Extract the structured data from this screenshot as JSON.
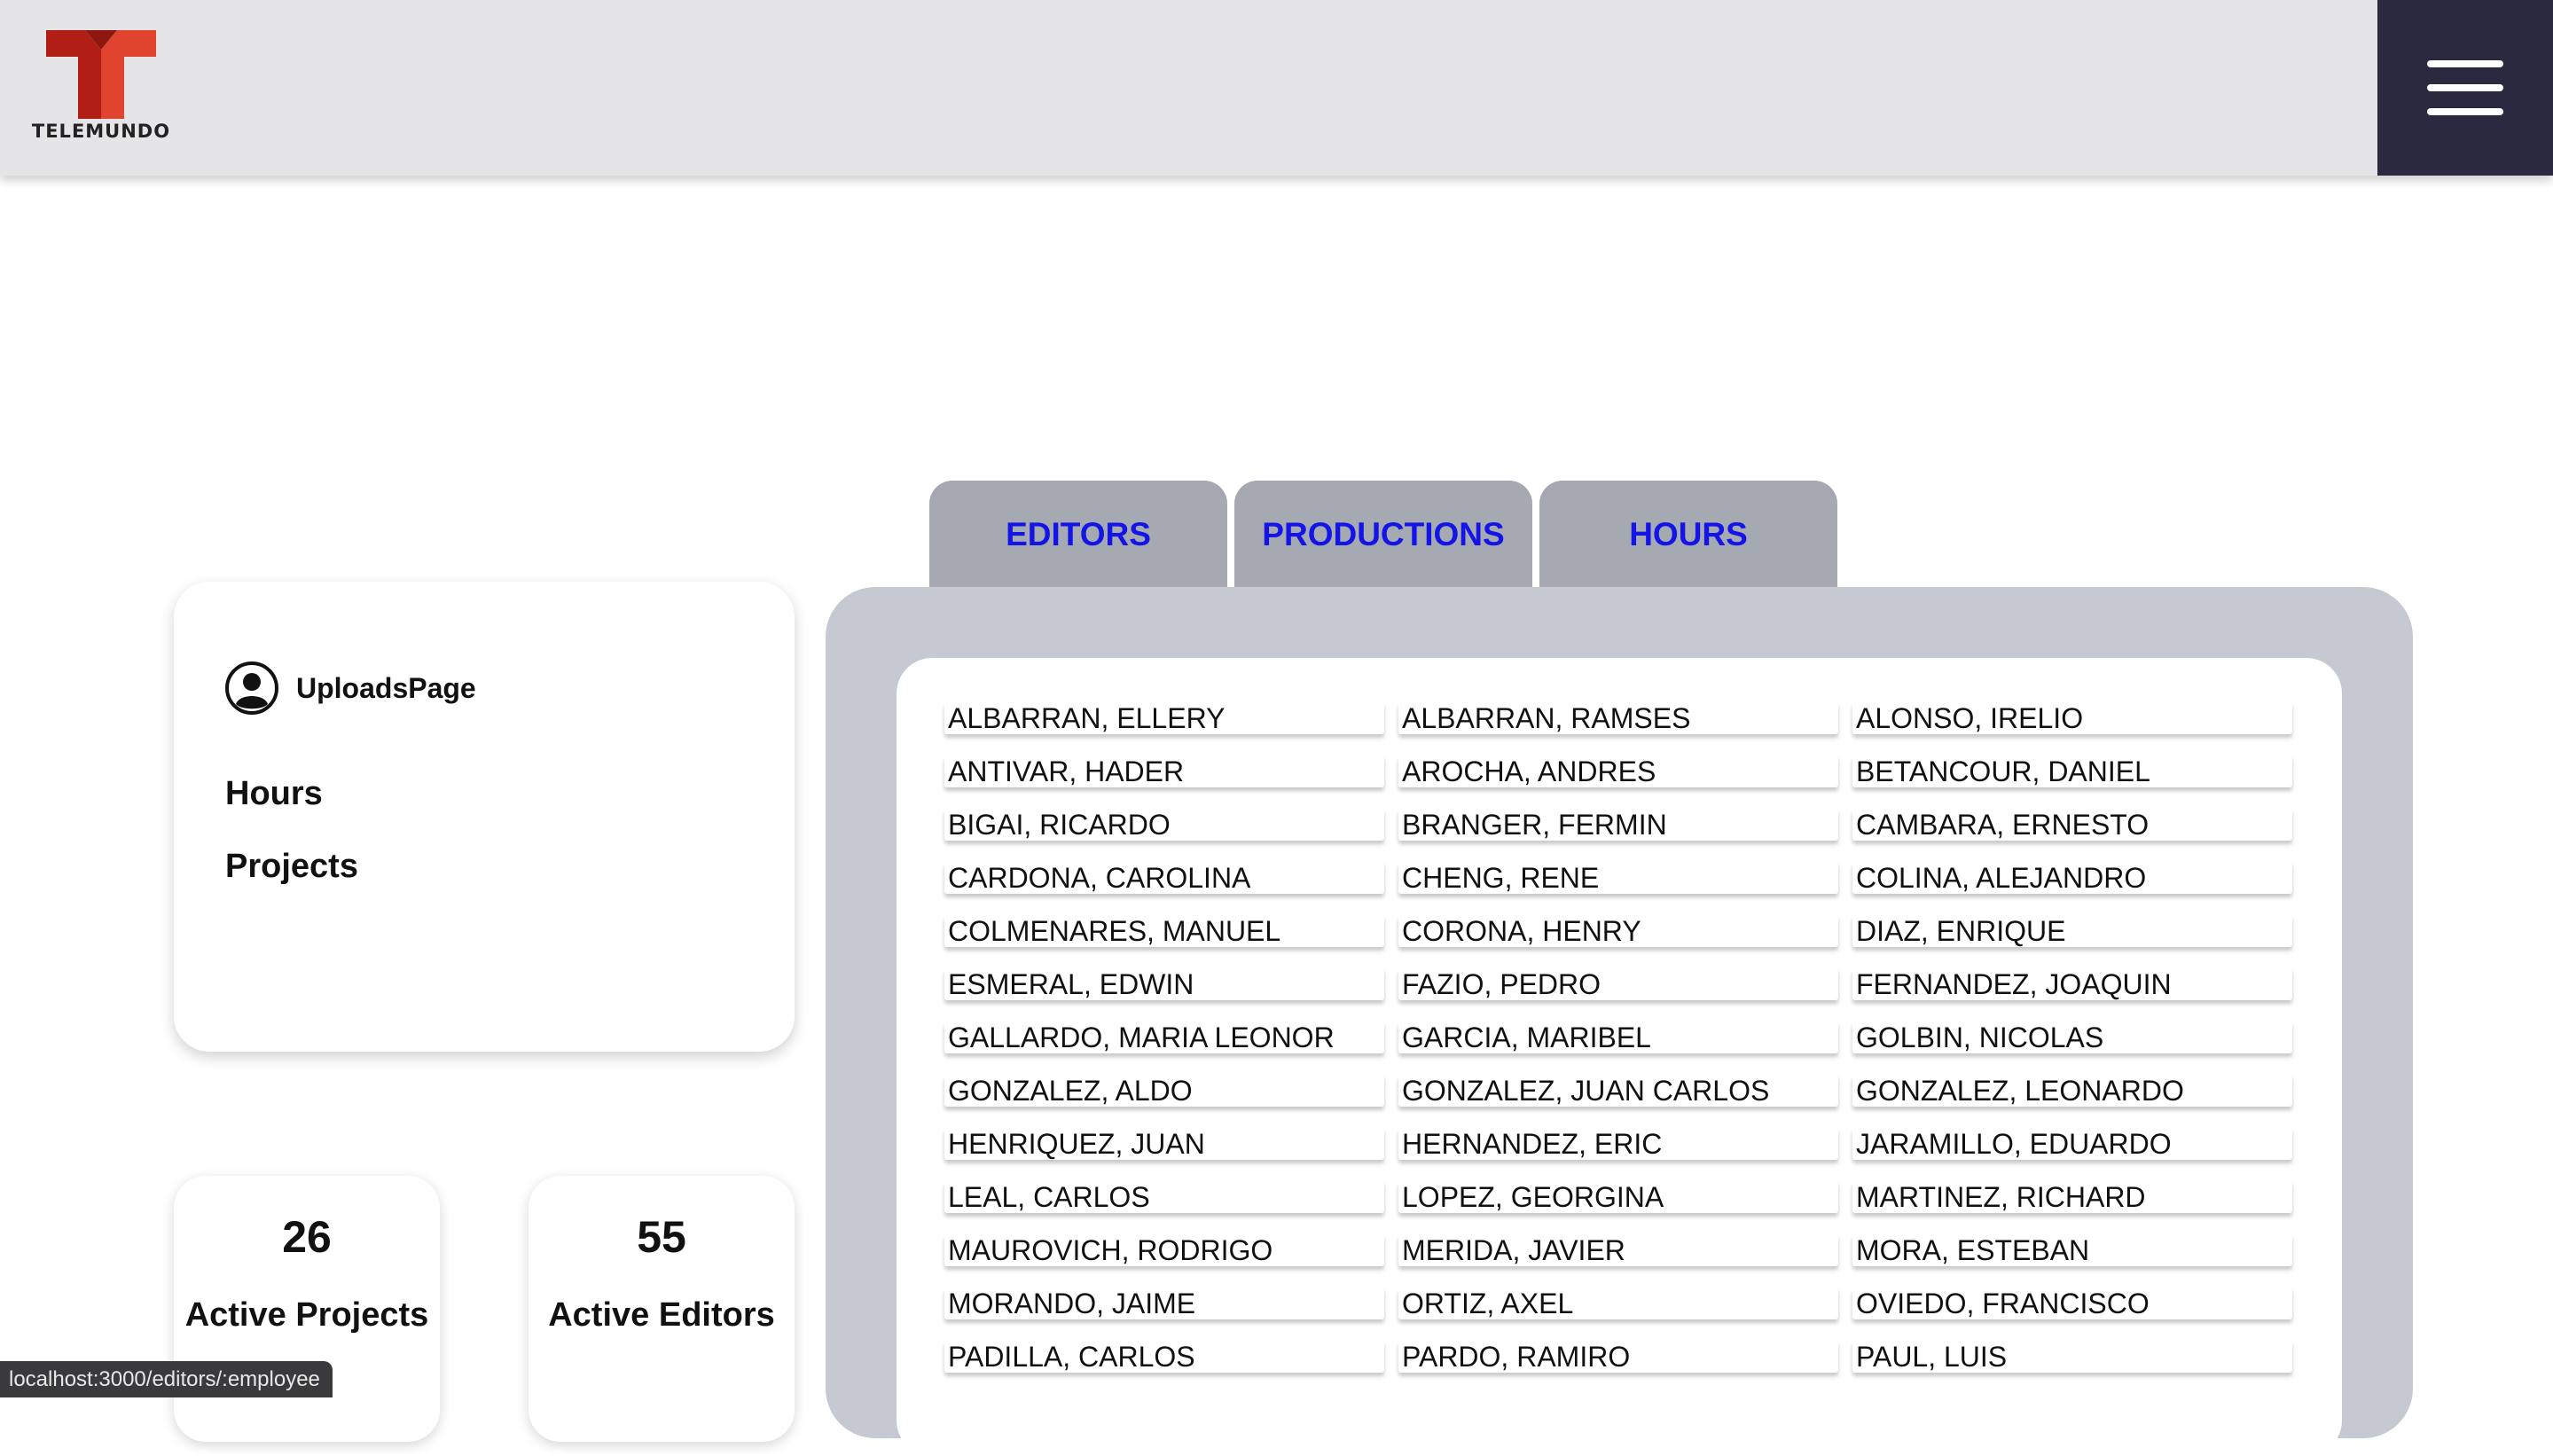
{
  "header": {
    "logo_text": "TELEMUNDO",
    "logo_color": "#c8281e",
    "menu_bg": "#2b2940"
  },
  "sidebar": {
    "user_label": "UploadsPage",
    "links": [
      "Hours",
      "Projects"
    ]
  },
  "stats": [
    {
      "value": "26",
      "label": "Active Projects"
    },
    {
      "value": "55",
      "label": "Active Editors"
    }
  ],
  "tabs": [
    "EDITORS",
    "PRODUCTIONS",
    "HOURS"
  ],
  "tab_text_color": "#1414e6",
  "editors": [
    "ALBARRAN, ELLERY",
    "ALBARRAN, RAMSES",
    "ALONSO, IRELIO",
    "ANTIVAR, HADER",
    "AROCHA, ANDRES",
    "BETANCOUR, DANIEL",
    "BIGAI, RICARDO",
    "BRANGER, FERMIN",
    "CAMBARA, ERNESTO",
    "CARDONA, CAROLINA",
    "CHENG, RENE",
    "COLINA, ALEJANDRO",
    "COLMENARES, MANUEL",
    "CORONA, HENRY",
    "DIAZ, ENRIQUE",
    "ESMERAL, EDWIN",
    "FAZIO, PEDRO",
    "FERNANDEZ, JOAQUIN",
    "GALLARDO, MARIA LEONOR",
    "GARCIA, MARIBEL",
    "GOLBIN, NICOLAS",
    "GONZALEZ, ALDO",
    "GONZALEZ, JUAN CARLOS",
    "GONZALEZ, LEONARDO",
    "HENRIQUEZ, JUAN",
    "HERNANDEZ, ERIC",
    "JARAMILLO, EDUARDO",
    "LEAL, CARLOS",
    "LOPEZ, GEORGINA",
    "MARTINEZ, RICHARD",
    "MAUROVICH, RODRIGO",
    "MERIDA, JAVIER",
    "MORA, ESTEBAN",
    "MORANDO, JAIME",
    "ORTIZ, AXEL",
    "OVIEDO, FRANCISCO",
    "PADILLA, CARLOS",
    "PARDO, RAMIRO",
    "PAUL, LUIS"
  ],
  "status_url": "localhost:3000/editors/:employee"
}
